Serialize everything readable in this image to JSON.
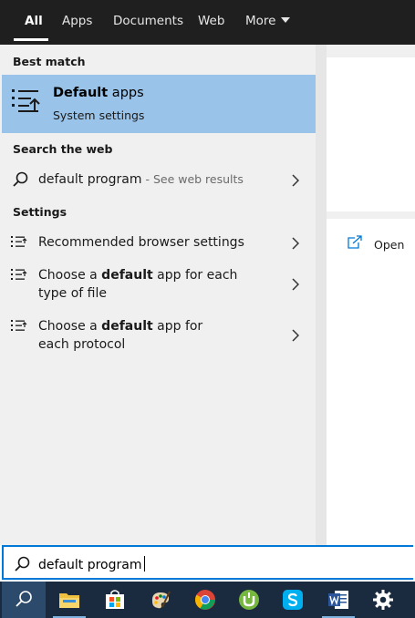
{
  "tabs": [
    {
      "label": "All",
      "active": true
    },
    {
      "label": "Apps"
    },
    {
      "label": "Documents"
    },
    {
      "label": "Web"
    },
    {
      "label": "More"
    }
  ],
  "sections": {
    "best_match": "Best match",
    "search_web": "Search the web",
    "settings": "Settings"
  },
  "best_match": {
    "title_bold": "Default",
    "title_rest": " apps",
    "subtitle": "System settings",
    "icon": "settings-list-icon"
  },
  "web_result": {
    "query": "default program",
    "suffix": " - See web results",
    "icon": "search-icon"
  },
  "settings_results": [
    {
      "pre": "Recommended browser settings",
      "bold": "",
      "post": ""
    },
    {
      "pre": "Choose a ",
      "bold": "default",
      "post": " app for each type of file"
    },
    {
      "pre": "Choose a ",
      "bold": "default",
      "post": " app for each protocol"
    }
  ],
  "preview": {
    "open_label": "Open"
  },
  "search": {
    "value": "default program"
  },
  "taskbar": [
    {
      "name": "search-icon"
    },
    {
      "name": "file-explorer-icon"
    },
    {
      "name": "store-icon"
    },
    {
      "name": "paint-icon"
    },
    {
      "name": "chrome-icon"
    },
    {
      "name": "utorrent-icon"
    },
    {
      "name": "skype-icon"
    },
    {
      "name": "word-icon"
    },
    {
      "name": "settings-gear-icon"
    }
  ],
  "colors": {
    "accent": "#0078d7",
    "selection": "#99c3e8",
    "topbar": "#1f1f1f",
    "taskbar": "#1b2b3f"
  }
}
